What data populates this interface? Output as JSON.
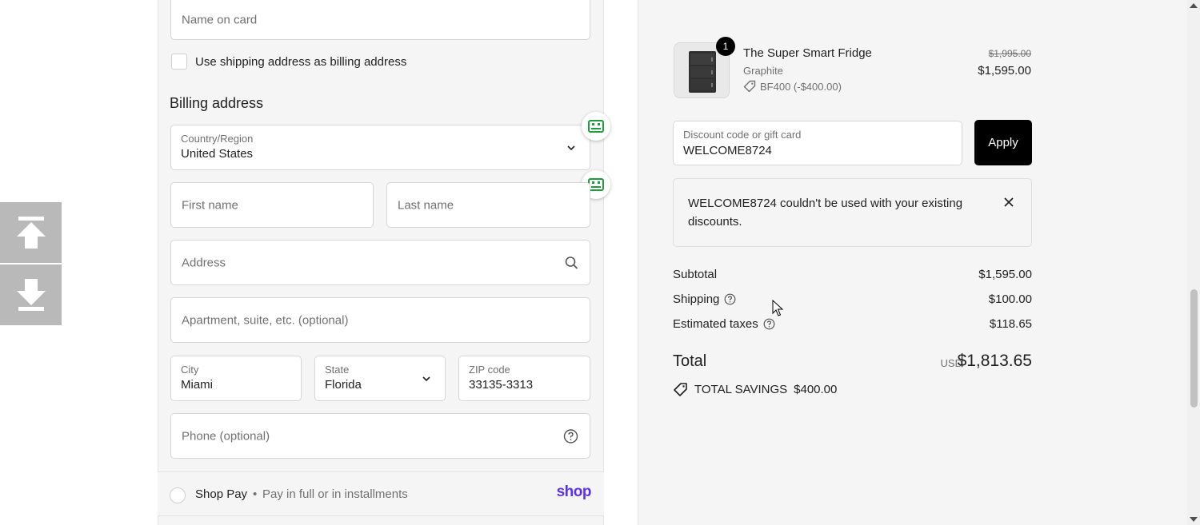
{
  "form": {
    "name_on_card_placeholder": "Name on card",
    "billing_checkbox_label": "Use shipping address as billing address",
    "billing_title": "Billing address",
    "country_label": "Country/Region",
    "country_value": "United States",
    "first_name_placeholder": "First name",
    "last_name_placeholder": "Last name",
    "address_placeholder": "Address",
    "apartment_placeholder": "Apartment, suite, etc. (optional)",
    "city_label": "City",
    "city_value": "Miami",
    "state_label": "State",
    "state_value": "Florida",
    "zip_label": "ZIP code",
    "zip_value": "33135-3313",
    "phone_placeholder": "Phone (optional)"
  },
  "shop_pay": {
    "title": "Shop Pay",
    "separator": "•",
    "subtitle": "Pay in full or in installments",
    "logo": "shop"
  },
  "product": {
    "quantity": "1",
    "name": "The Super Smart Fridge",
    "variant": "Graphite",
    "discount": "BF400 (-$400.00)",
    "price_original": "$1,995.00",
    "price": "$1,595.00"
  },
  "discount": {
    "label": "Discount code or gift card",
    "value": "WELCOME8724",
    "apply_label": "Apply",
    "notice": "WELCOME8724 couldn't be used with your existing discounts."
  },
  "summary": {
    "subtotal_label": "Subtotal",
    "subtotal_value": "$1,595.00",
    "shipping_label": "Shipping",
    "shipping_value": "$100.00",
    "taxes_label": "Estimated taxes",
    "taxes_value": "$118.65",
    "total_label": "Total",
    "total_currency": "USD",
    "total_value": "$1,813.65",
    "savings_label": "TOTAL SAVINGS",
    "savings_value": "$400.00"
  },
  "icons": {
    "up": "arrow-up-icon",
    "down": "arrow-down-icon",
    "autofill": "contact-card-icon",
    "search": "search-icon",
    "help": "help-circle-icon",
    "tag": "tag-icon",
    "close": "close-icon"
  },
  "colors": {
    "accent": "#000000",
    "shop_pay": "#5a31f4",
    "autofill": "#1a9f3a"
  }
}
